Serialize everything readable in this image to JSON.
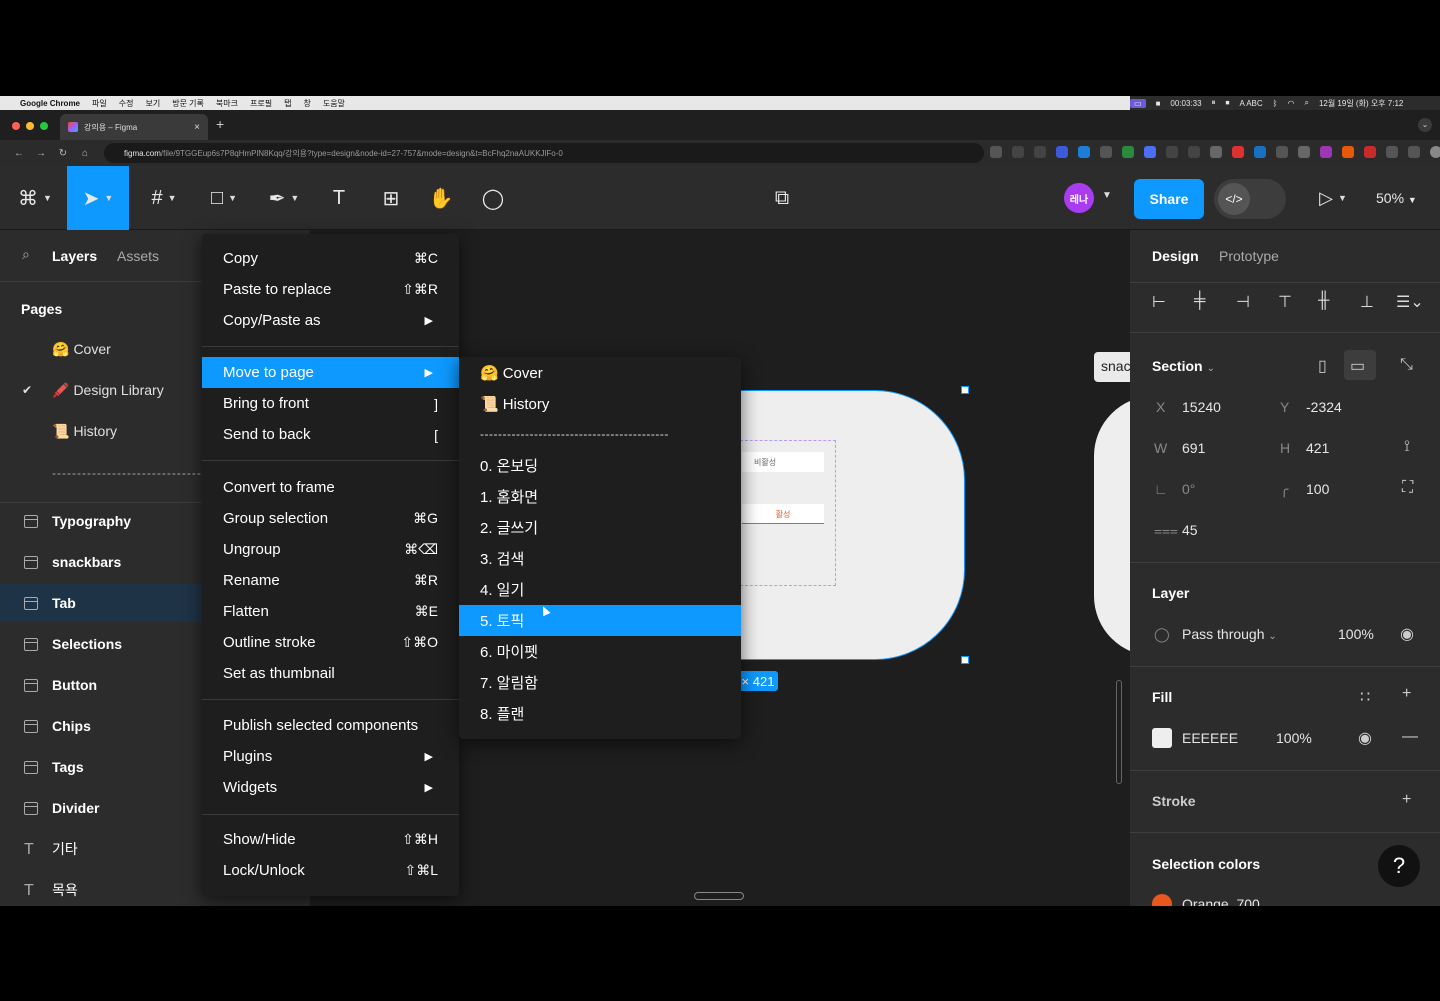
{
  "macbar": {
    "app": "Google Chrome",
    "menus": [
      "파일",
      "수정",
      "보기",
      "방문 기록",
      "북마크",
      "프로필",
      "탭",
      "창",
      "도움말"
    ],
    "timer": "00:03:33",
    "input_label": "A ABC",
    "datetime": "12월 19일 (화) 오후 7:12"
  },
  "browser": {
    "tab_title": "강의용 – Figma",
    "url_host": "figma.com",
    "url_path": "/file/9TGGEup6s7P8qHmPlN8Kqq/강의용?type=design&node-id=27-757&mode=design&t=BcFhq2naAUKKJlFo-0"
  },
  "toolbar": {
    "avatar_initials": "레나",
    "share_label": "Share",
    "zoom": "50%"
  },
  "left_panel": {
    "tab_layers": "Layers",
    "tab_assets": "Assets",
    "pages_title": "Pages",
    "pages": [
      {
        "emoji": "🤗",
        "name": "Cover",
        "checked": false
      },
      {
        "emoji": "🖍️",
        "name": "Design Library",
        "checked": true
      },
      {
        "emoji": "📜",
        "name": "History",
        "checked": false
      }
    ],
    "separator": "-----------------------------------------",
    "layers": [
      {
        "name": "Typography",
        "icon": "section-icon"
      },
      {
        "name": "snackbars",
        "icon": "section-icon"
      },
      {
        "name": "Tab",
        "icon": "section-icon"
      },
      {
        "name": "Selections",
        "icon": "section-icon"
      },
      {
        "name": "Button",
        "icon": "section-icon"
      },
      {
        "name": "Chips",
        "icon": "section-icon"
      },
      {
        "name": "Tags",
        "icon": "section-icon"
      },
      {
        "name": "Divider",
        "icon": "section-icon"
      },
      {
        "name": "기타",
        "icon": "text-icon"
      },
      {
        "name": "목욕",
        "icon": "text-icon"
      }
    ],
    "selected_layer": "Tab"
  },
  "context_menu": {
    "items": [
      {
        "label": "Copy",
        "shortcut": "⌘C"
      },
      {
        "label": "Paste to replace",
        "shortcut": "⇧⌘R"
      },
      {
        "label": "Copy/Paste as",
        "submenu": true
      },
      {
        "label": "Move to page",
        "submenu": true,
        "highlighted": true
      },
      {
        "label": "Bring to front",
        "shortcut": "]"
      },
      {
        "label": "Send to back",
        "shortcut": "["
      },
      {
        "label": "Convert to frame",
        "shortcut": ""
      },
      {
        "label": "Group selection",
        "shortcut": "⌘G"
      },
      {
        "label": "Ungroup",
        "shortcut": "⌘⌫"
      },
      {
        "label": "Rename",
        "shortcut": "⌘R"
      },
      {
        "label": "Flatten",
        "shortcut": "⌘E"
      },
      {
        "label": "Outline stroke",
        "shortcut": "⇧⌘O"
      },
      {
        "label": "Set as thumbnail",
        "shortcut": ""
      },
      {
        "label": "Publish selected components",
        "shortcut": ""
      },
      {
        "label": "Plugins",
        "submenu": true
      },
      {
        "label": "Widgets",
        "submenu": true
      },
      {
        "label": "Show/Hide",
        "shortcut": "⇧⌘H"
      },
      {
        "label": "Lock/Unlock",
        "shortcut": "⇧⌘L"
      }
    ]
  },
  "submenu": {
    "items": [
      {
        "emoji": "🤗",
        "label": "Cover"
      },
      {
        "emoji": "📜",
        "label": "History"
      }
    ],
    "separator": "------------------------------------------",
    "pages": [
      "0. 온보딩",
      "1. 홈화면",
      "2. 글쓰기",
      "3. 검색",
      "4. 일기",
      "5. 토픽",
      "6. 마이펫",
      "7. 알림함",
      "8. 플랜"
    ],
    "highlighted": "5. 토픽"
  },
  "canvas": {
    "chip_inactive": "비활성",
    "chip_active": "활성",
    "dimension_tag": "× 421",
    "snack_label": "snac"
  },
  "right_panel": {
    "tab_design": "Design",
    "tab_prototype": "Prototype",
    "section_label": "Section",
    "x_label": "X",
    "x": "15240",
    "y_label": "Y",
    "y": "-2324",
    "w_label": "W",
    "w": "691",
    "h_label": "H",
    "h": "421",
    "rotation": "0°",
    "radius": "100",
    "spacing": "45",
    "layer_title": "Layer",
    "blend": "Pass through",
    "opacity": "100%",
    "fill_title": "Fill",
    "fill_hex": "EEEEEE",
    "fill_opacity": "100%",
    "stroke_title": "Stroke",
    "selection_colors_title": "Selection colors",
    "selection_color": "Orange_700"
  },
  "colors": {
    "accent": "#0d99ff",
    "panel": "#2c2c2c",
    "canvas": "#1e1e1e",
    "fill": "#eeeeee"
  }
}
